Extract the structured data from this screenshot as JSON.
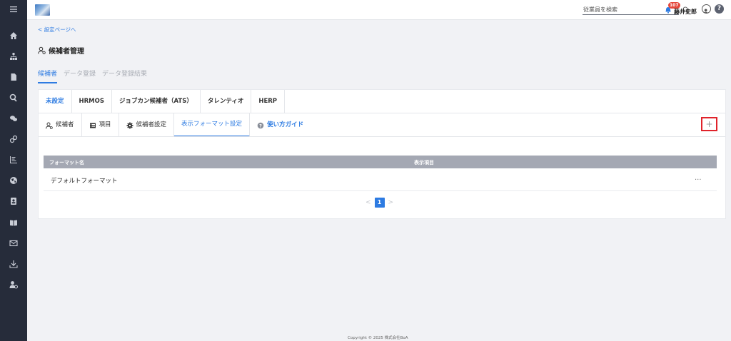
{
  "sidebar": {
    "items": [
      {
        "icon": "menu-icon"
      },
      {
        "icon": "home-icon"
      },
      {
        "icon": "org-chart-icon"
      },
      {
        "icon": "document-icon"
      },
      {
        "icon": "search-icon"
      },
      {
        "icon": "chat-icon"
      },
      {
        "icon": "link-icon"
      },
      {
        "icon": "bar-chart-icon"
      },
      {
        "icon": "globe-icon"
      },
      {
        "icon": "contact-icon"
      },
      {
        "icon": "book-icon"
      },
      {
        "icon": "mail-icon"
      },
      {
        "icon": "download-icon"
      },
      {
        "icon": "user-settings-icon"
      }
    ]
  },
  "header": {
    "search_placeholder": "従業員を検索",
    "notification_count": "107",
    "username": "藤井史郎",
    "help_label": "?"
  },
  "breadcrumb": "< 設定ページへ",
  "page_title": "候補者管理",
  "main_tabs": [
    {
      "label": "候補者",
      "active": true
    },
    {
      "label": "データ登録",
      "active": false
    },
    {
      "label": "データ登録結果",
      "active": false
    }
  ],
  "ats_tabs": [
    {
      "label": "未設定",
      "active": true
    },
    {
      "label": "HRMOS",
      "active": false
    },
    {
      "label": "ジョブカン候補者（ATS）",
      "active": false
    },
    {
      "label": "タレンティオ",
      "active": false
    },
    {
      "label": "HERP",
      "active": false
    }
  ],
  "sub_tabs": [
    {
      "label": "候補者",
      "icon": "candidate-icon",
      "active": false
    },
    {
      "label": "項目",
      "icon": "list-icon",
      "active": false
    },
    {
      "label": "候補者設定",
      "icon": "gear-icon",
      "active": false
    },
    {
      "label": "表示フォーマット設定",
      "icon": "",
      "active": true
    },
    {
      "label": "使い方ガイド",
      "icon": "question-icon",
      "active": false
    }
  ],
  "add_button_label": "+",
  "table": {
    "columns": [
      "フォーマット名",
      "表示項目"
    ],
    "rows": [
      {
        "name": "デフォルトフォーマット",
        "action": "..."
      }
    ]
  },
  "pagination": {
    "prev": "<",
    "current": "1",
    "next": ">"
  },
  "footer": "Copyright © 2025 株式会社BoA",
  "colors": {
    "accent": "#2d7be2",
    "sidebar": "#262c3a",
    "highlight": "#e0232b",
    "table_header": "#a4a8b3"
  }
}
